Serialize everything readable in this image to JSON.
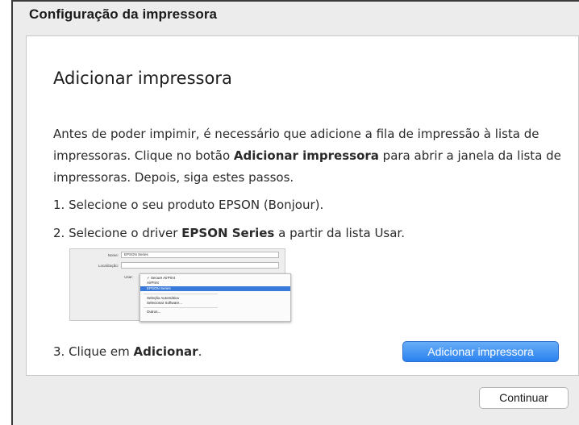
{
  "window": {
    "title": "Configuração da impressora"
  },
  "panel": {
    "heading": "Adicionar impressora",
    "paragraph": {
      "part1": "Antes de poder impimir, é necessário que adicione a fila de impressão à lista de impressoras. Clique no botão ",
      "bold": "Adicionar impressora",
      "part2": " para abrir a janela da lista de impressoras. Depois, siga estes passos."
    },
    "steps": [
      {
        "prefix": "1. Selecione o seu produto EPSON (Bonjour).",
        "bold": "",
        "suffix": ""
      },
      {
        "prefix": "2. Selecione o driver ",
        "bold": "EPSON Series",
        "suffix": " a partir da lista Usar."
      },
      {
        "prefix": "3. Clique em ",
        "bold": "Adicionar",
        "suffix": "."
      }
    ],
    "thumbnail": {
      "name_label": "Nome:",
      "name_value": "EPSON Series",
      "location_label": "Localização:",
      "use_label": "Usar:",
      "menu_items": [
        "✓ Secure AirPrint",
        "AirPrint",
        "EPSON Series",
        "Seleção Automática",
        "Selecionar Software...",
        "Outros..."
      ],
      "selected_item": "EPSON Series"
    },
    "add_printer_button": "Adicionar impressora"
  },
  "footer": {
    "continue_button": "Continuar"
  },
  "colors": {
    "accent": "#2a82f0",
    "window_bg": "#ececec",
    "panel_bg": "#ffffff"
  }
}
